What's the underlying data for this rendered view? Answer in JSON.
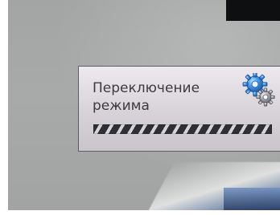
{
  "dialog": {
    "title": "Переключение\nрежима",
    "icon": "gear-icon",
    "progress_state": "indeterminate"
  },
  "colors": {
    "dialog_text": "#3b3b3f",
    "progress_dark": "#2f3036",
    "progress_light": "#d7d4d9",
    "gear_blue": "#3a82d8"
  }
}
